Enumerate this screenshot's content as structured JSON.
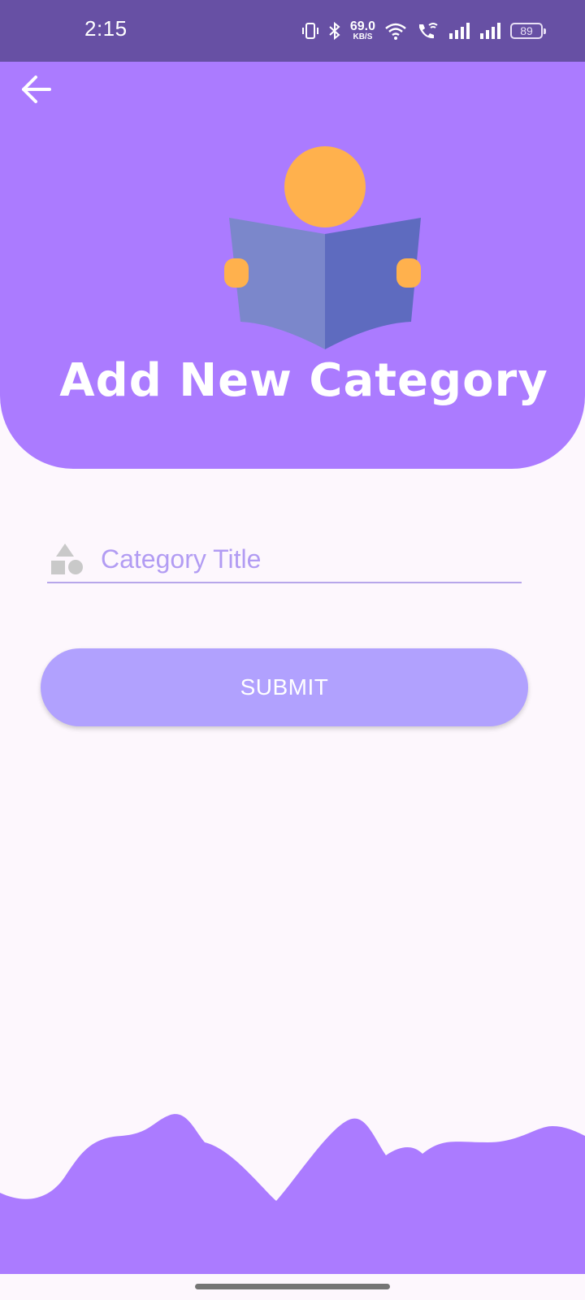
{
  "status_bar": {
    "time": "2:15",
    "net_speed_value": "69.0",
    "net_speed_unit": "KB/S",
    "battery": "89",
    "icons": [
      "vibrate-icon",
      "bluetooth-icon",
      "wifi-icon",
      "wifi-calling-icon",
      "signal-icon",
      "signal-icon"
    ]
  },
  "header": {
    "title": "Add New Category",
    "back_icon": "arrow-left-icon",
    "illustration": "person-reading-book"
  },
  "form": {
    "field_icon": "shapes-icon",
    "category_title_value": "",
    "category_title_placeholder": "Category Title",
    "submit_label": "SUBMIT"
  },
  "colors": {
    "status_bar": "#6750a4",
    "header": "#ab7bff",
    "background": "#fdf7fd",
    "button": "#b1a1fe",
    "placeholder": "#b29cf3",
    "underline": "#b7a6ea",
    "accent_orange": "#ffb14d",
    "book_left": "#7b87cb",
    "book_right": "#5e6bbf"
  }
}
